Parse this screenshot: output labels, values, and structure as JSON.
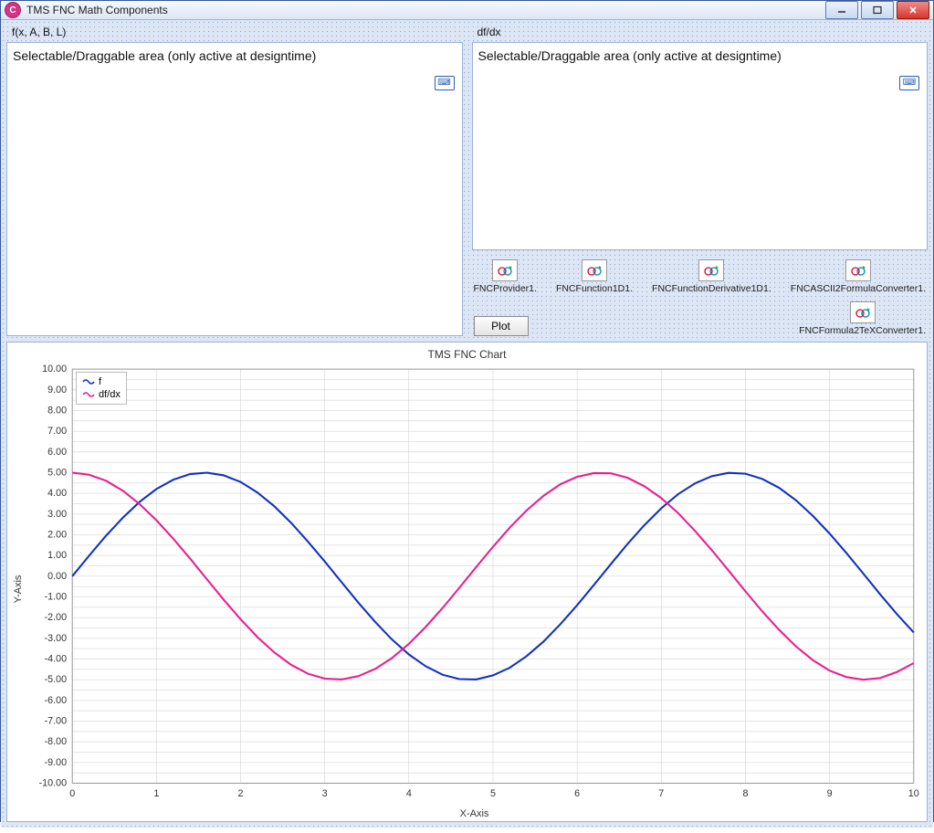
{
  "window": {
    "title": "TMS FNC Math Components"
  },
  "topPanels": {
    "left": {
      "label": "f(x, A, B, L)",
      "placeholder": "Selectable/Draggable area (only active at designtime)"
    },
    "right": {
      "label": "df/dx",
      "placeholder": "Selectable/Draggable area (only active at designtime)"
    }
  },
  "components": [
    {
      "name": "FNCProvider1."
    },
    {
      "name": "FNCFunction1D1."
    },
    {
      "name": "FNCFunctionDerivative1D1."
    },
    {
      "name": "FNCASCII2FormulaConverter1."
    },
    {
      "name": "FNCFormula2TeXConverter1."
    }
  ],
  "plotButton": "Plot",
  "chart": {
    "title": "TMS FNC Chart",
    "xlabel": "X-Axis",
    "ylabel": "Y-Axis",
    "legend": [
      {
        "name": "f",
        "color": "#1030c0"
      },
      {
        "name": "df/dx",
        "color": "#e91e8c"
      }
    ]
  },
  "chart_data": {
    "type": "line",
    "title": "TMS FNC Chart",
    "xlabel": "X-Axis",
    "ylabel": "Y-Axis",
    "xlim": [
      0,
      10
    ],
    "ylim": [
      -10,
      10
    ],
    "xticks": [
      0,
      1,
      2,
      3,
      4,
      5,
      6,
      7,
      8,
      9,
      10
    ],
    "yticks": [
      -10,
      -9,
      -8,
      -7,
      -6,
      -5,
      -4,
      -3,
      -2,
      -1,
      0,
      1,
      2,
      3,
      4,
      5,
      6,
      7,
      8,
      9,
      10
    ],
    "series": [
      {
        "name": "f",
        "color": "#1030c0",
        "x": [
          0.0,
          0.2,
          0.4,
          0.6,
          0.8,
          1.0,
          1.2,
          1.4,
          1.6,
          1.8,
          2.0,
          2.2,
          2.4,
          2.6,
          2.8,
          3.0,
          3.2,
          3.4,
          3.6,
          3.8,
          4.0,
          4.2,
          4.4,
          4.6,
          4.8,
          5.0,
          5.2,
          5.4,
          5.6,
          5.8,
          6.0,
          6.2,
          6.4,
          6.6,
          6.8,
          7.0,
          7.2,
          7.4,
          7.6,
          7.8,
          8.0,
          8.2,
          8.4,
          8.6,
          8.8,
          9.0,
          9.2,
          9.4,
          9.6,
          9.8,
          10.0
        ],
        "y": [
          0.0,
          0.99,
          1.95,
          2.82,
          3.59,
          4.21,
          4.66,
          4.93,
          5.0,
          4.87,
          4.55,
          4.04,
          3.38,
          2.58,
          1.67,
          0.71,
          -0.29,
          -1.28,
          -2.21,
          -3.06,
          -3.78,
          -4.35,
          -4.76,
          -4.97,
          -4.99,
          -4.79,
          -4.42,
          -3.86,
          -3.16,
          -2.32,
          -1.4,
          -0.42,
          0.58,
          1.56,
          2.47,
          3.28,
          3.96,
          4.48,
          4.83,
          4.99,
          4.95,
          4.7,
          4.27,
          3.67,
          2.92,
          2.06,
          1.12,
          0.13,
          -0.87,
          -1.83,
          -2.72
        ]
      },
      {
        "name": "df/dx",
        "color": "#e91e8c",
        "x": [
          0.0,
          0.2,
          0.4,
          0.6,
          0.8,
          1.0,
          1.2,
          1.4,
          1.6,
          1.8,
          2.0,
          2.2,
          2.4,
          2.6,
          2.8,
          3.0,
          3.2,
          3.4,
          3.6,
          3.8,
          4.0,
          4.2,
          4.4,
          4.6,
          4.8,
          5.0,
          5.2,
          5.4,
          5.6,
          5.8,
          6.0,
          6.2,
          6.4,
          6.6,
          6.8,
          7.0,
          7.2,
          7.4,
          7.6,
          7.8,
          8.0,
          8.2,
          8.4,
          8.6,
          8.8,
          9.0,
          9.2,
          9.4,
          9.6,
          9.8,
          10.0
        ],
        "y": [
          5.0,
          4.9,
          4.61,
          4.13,
          3.48,
          2.7,
          1.81,
          0.85,
          -0.15,
          -1.14,
          -2.08,
          -2.94,
          -3.68,
          -4.28,
          -4.71,
          -4.95,
          -4.99,
          -4.83,
          -4.48,
          -3.95,
          -3.27,
          -2.45,
          -1.54,
          -0.56,
          0.44,
          1.42,
          2.35,
          3.18,
          3.88,
          4.44,
          4.8,
          4.98,
          4.97,
          4.75,
          4.34,
          3.77,
          3.05,
          2.19,
          1.26,
          0.27,
          -0.73,
          -1.7,
          -2.59,
          -3.39,
          -4.05,
          -4.56,
          -4.87,
          -5.0,
          -4.92,
          -4.63,
          -4.2
        ]
      }
    ]
  }
}
